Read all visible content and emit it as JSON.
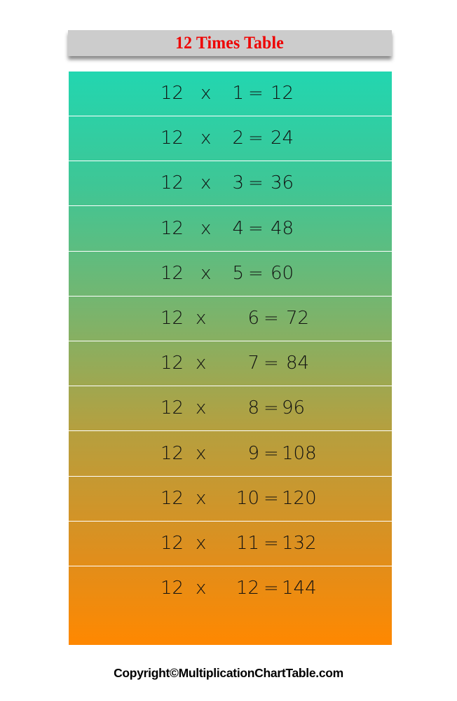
{
  "title": "12 Times Table",
  "rows": [
    {
      "a": "12",
      "op": "x",
      "b": "1",
      "eq": "=",
      "result": "12"
    },
    {
      "a": "12",
      "op": "x",
      "b": "2",
      "eq": "=",
      "result": "24"
    },
    {
      "a": "12",
      "op": "x",
      "b": "3",
      "eq": "=",
      "result": "36"
    },
    {
      "a": "12",
      "op": "x",
      "b": "4",
      "eq": "=",
      "result": "48"
    },
    {
      "a": "12",
      "op": "x",
      "b": "5",
      "eq": "=",
      "result": "60"
    },
    {
      "a": "12",
      "op": "x",
      "b": "6",
      "eq": "=",
      "result": "72"
    },
    {
      "a": "12",
      "op": "x",
      "b": "7",
      "eq": "=",
      "result": "84"
    },
    {
      "a": "12",
      "op": "x",
      "b": "8",
      "eq": "=",
      "result": "96"
    },
    {
      "a": "12",
      "op": "x",
      "b": "9",
      "eq": "=",
      "result": "108"
    },
    {
      "a": "12",
      "op": "x",
      "b": "10",
      "eq": "=",
      "result": "120"
    },
    {
      "a": "12",
      "op": "x",
      "b": "11",
      "eq": "=",
      "result": "132"
    },
    {
      "a": "12",
      "op": "x",
      "b": "12",
      "eq": "=",
      "result": "144"
    }
  ],
  "colors": {
    "title_text": "#ee0000",
    "title_bar": "#cccccc",
    "gradient_top": "#22d6b0",
    "gradient_bottom": "#ff8800"
  },
  "footer": "Copyright©MultiplicationChartTable.com"
}
